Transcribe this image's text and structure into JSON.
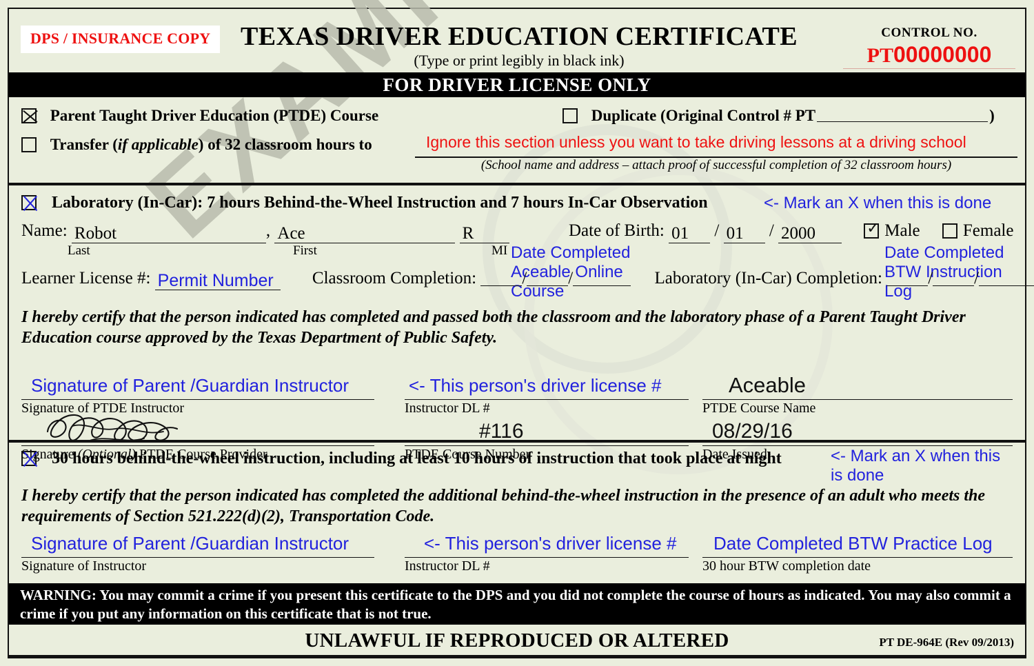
{
  "header": {
    "copy_label": "DPS / INSURANCE COPY",
    "title": "TEXAS DRIVER EDUCATION CERTIFICATE",
    "subtitle": "(Type or print legibly in black ink)",
    "control_label": "CONTROL NO.",
    "control_prefix": "PT",
    "control_number": "00000000",
    "banner": "FOR DRIVER LICENSE ONLY"
  },
  "section_course": {
    "ptde_checkbox_checked": true,
    "ptde_label": "Parent Taught Driver Education (PTDE) Course",
    "duplicate_checkbox_checked": false,
    "duplicate_label_pre": "Duplicate (Original Control # PT",
    "duplicate_label_post": ")",
    "duplicate_value": "",
    "transfer_checkbox_checked": false,
    "transfer_label_pre": "Transfer (",
    "transfer_label_italic": "if applicable",
    "transfer_label_post": ") of 32 classroom hours to",
    "transfer_value": "",
    "transfer_annotation": "Ignore this section unless you want to take driving lessons at a driving school",
    "transfer_caption": "(School name and address – attach proof of successful completion of 32 classroom hours)"
  },
  "section_lab": {
    "lab_checkbox_checked": true,
    "lab_heading": "Laboratory (In-Car):  7 hours Behind-the-Wheel Instruction and 7 hours In-Car Observation",
    "lab_annotation": "<- Mark an X when this is done",
    "name_label": "Name:",
    "last_name": "Robot",
    "first_name": "Ace",
    "middle_initial": "R",
    "cap_last": "Last",
    "cap_first": "First",
    "cap_mi": "MI",
    "dob_label": "Date of Birth:",
    "dob_month": "01",
    "dob_day": "01",
    "dob_year": "2000",
    "male_label": "Male",
    "male_checked": true,
    "female_label": "Female",
    "female_checked": false,
    "learner_license_label": "Learner License #:",
    "learner_license_value": "Permit Number",
    "classroom_label": "Classroom Completion:",
    "classroom_annotation": "Date Completed Aceable Online Course",
    "lab_completion_label": "Laboratory (In-Car) Completion:",
    "lab_completion_annotation": "Date Completed BTW Instruction Log",
    "certify_text": "I hereby certify that the person indicated has completed and passed both the classroom and the laboratory phase of a Parent Taught Driver Education course approved by the Texas Department of Public Safety.",
    "sig_instructor_annotation": "Signature of Parent /Guardian Instructor",
    "sig_instructor_caption": "Signature of PTDE Instructor",
    "sig_provider_value": "",
    "sig_provider_caption": "Signature (Optional) PTDE Course Provider",
    "sig_provider_caption_pre": "Signature ",
    "sig_provider_caption_italic": "(Optional)",
    "sig_provider_caption_post": " PTDE Course Provider",
    "instructor_dl_annotation": "<- This person's driver license #",
    "instructor_dl_caption": "Instructor DL #",
    "course_number_value": "#116",
    "course_number_caption": "PTDE Course Number",
    "course_name_value": "Aceable",
    "course_name_caption": "PTDE Course Name",
    "date_issued_value": "08/29/16",
    "date_issued_caption": "Date Issued"
  },
  "section_btw": {
    "btw_checkbox_checked": true,
    "btw_heading": "30 hours behind-the-wheel instruction, including at least 10 hours of instruction that took place at night",
    "btw_annotation": "<- Mark an X when this is done",
    "certify_text": "I hereby certify that the person indicated has completed the additional behind-the-wheel instruction in the presence of an adult who meets the requirements of Section 521.222(d)(2), Transportation Code.",
    "sig_annotation": "Signature of Parent /Guardian Instructor",
    "sig_caption": "Signature of Instructor",
    "dl_annotation": "<- This person's driver license #",
    "dl_caption": "Instructor DL #",
    "date_annotation": "Date Completed BTW Practice Log",
    "date_caption": "30 hour BTW completion date"
  },
  "warning": {
    "text": "WARNING: You may commit a crime if you present this certificate to the DPS and you did not complete the course of hours as indicated.  You may also commit a crime if you put any information on this certificate that is not true."
  },
  "footer": {
    "title": "UNLAWFUL IF REPRODUCED OR ALTERED",
    "revision": "PT DE-964E (Rev 09/2013)"
  },
  "watermark": {
    "text": "EXAMPLE ONLY"
  },
  "colors": {
    "paper": "#eaeedd",
    "red": "#ee1111",
    "blue": "#2222dd",
    "ink": "#111111"
  }
}
